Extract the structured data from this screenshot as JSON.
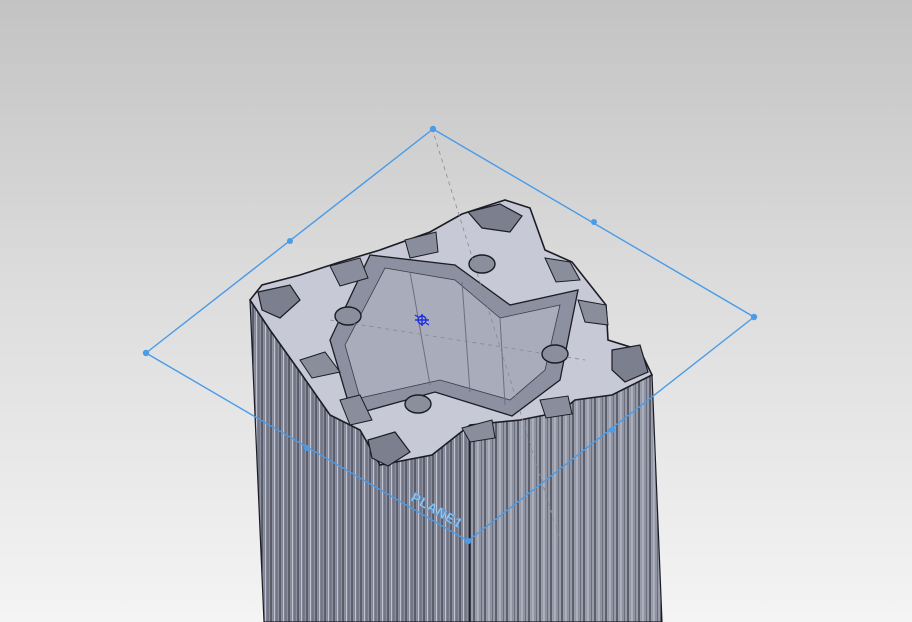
{
  "viewport": {
    "plane_label": "PLANE1"
  },
  "colors": {
    "background_top": "#c3c3c3",
    "background_bottom": "#f4f4f4",
    "plane_outline": "#4a9be8",
    "profile_face": "#c9cad8",
    "profile_side": "#8c90a0",
    "profile_edge": "#1c1c24",
    "origin_marker": "#1a2be0"
  },
  "icons": {
    "origin": "coordinate-origin-icon"
  }
}
